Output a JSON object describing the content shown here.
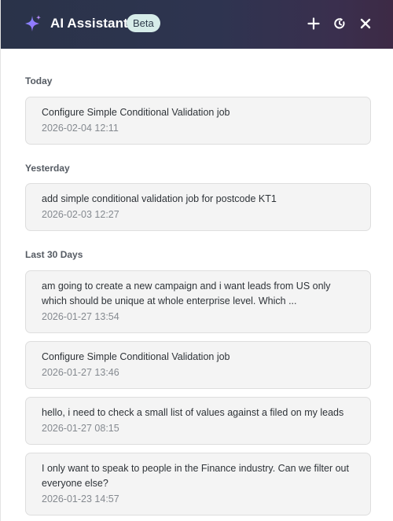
{
  "header": {
    "title": "AI Assistant",
    "badge": "Beta",
    "accent_gradient": [
      "#2a3349",
      "#3d2a45"
    ],
    "icons": [
      "sparkle-icon",
      "plus-icon",
      "history-icon",
      "close-icon"
    ]
  },
  "sections": [
    {
      "label": "Today",
      "items": [
        {
          "text": "Configure Simple Conditional Validation job",
          "time": "2026-02-04 12:11"
        }
      ]
    },
    {
      "label": "Yesterday",
      "items": [
        {
          "text": "add simple conditional validation job for postcode KT1",
          "time": "2026-02-03 12:27"
        }
      ]
    },
    {
      "label": "Last 30 Days",
      "items": [
        {
          "text": "am going to create a new campaign and i want leads from US only which should be unique at whole enterprise level. Which ...",
          "time": "2026-01-27 13:54"
        },
        {
          "text": "Configure Simple Conditional Validation job",
          "time": "2026-01-27 13:46"
        },
        {
          "text": "hello, i need to check a small list of values against a filed on my leads",
          "time": "2026-01-27 08:15"
        },
        {
          "text": "I only want to speak to people in the Finance industry. Can we filter out everyone else?",
          "time": "2026-01-23 14:57"
        }
      ]
    }
  ]
}
